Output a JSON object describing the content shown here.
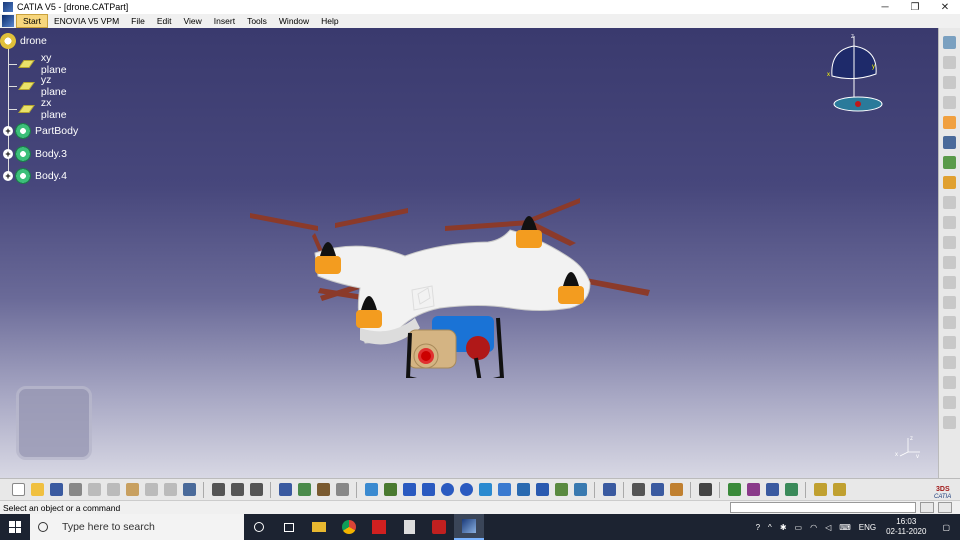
{
  "window": {
    "title": "CATIA V5 - [drone.CATPart]",
    "controls": [
      "─",
      "❐",
      "✕"
    ]
  },
  "menu": [
    {
      "label": "Start",
      "active": true
    },
    {
      "label": "ENOVIA V5 VPM"
    },
    {
      "label": "File"
    },
    {
      "label": "Edit"
    },
    {
      "label": "View"
    },
    {
      "label": "Insert"
    },
    {
      "label": "Tools"
    },
    {
      "label": "Window"
    },
    {
      "label": "Help"
    }
  ],
  "tree": {
    "root": "drone",
    "items": [
      {
        "label": "xy plane",
        "type": "plane"
      },
      {
        "label": "yz plane",
        "type": "plane"
      },
      {
        "label": "zx plane",
        "type": "plane"
      },
      {
        "label": "PartBody",
        "type": "body"
      },
      {
        "label": "Body.3",
        "type": "body"
      },
      {
        "label": "Body.4",
        "type": "body"
      }
    ]
  },
  "compass": {
    "z": "z",
    "x": "x",
    "y": "y"
  },
  "axis_triad": {
    "x": "x",
    "y": "y",
    "z": "z"
  },
  "status": {
    "message": "Select an object or a command"
  },
  "taskbar": {
    "search_placeholder": "Type here to search",
    "language": "ENG",
    "time": "16:03",
    "date": "02-11-2020"
  },
  "colors": {
    "viewport_top": "#3a3a6e",
    "viewport_bottom": "#d8d8e4",
    "drone_body": "#f2f2f2",
    "rotor_blade": "#8b3a2a",
    "motor": "#f39c1f",
    "camera_housing": "#1a73d6",
    "camera_lens": "#d4b483"
  }
}
